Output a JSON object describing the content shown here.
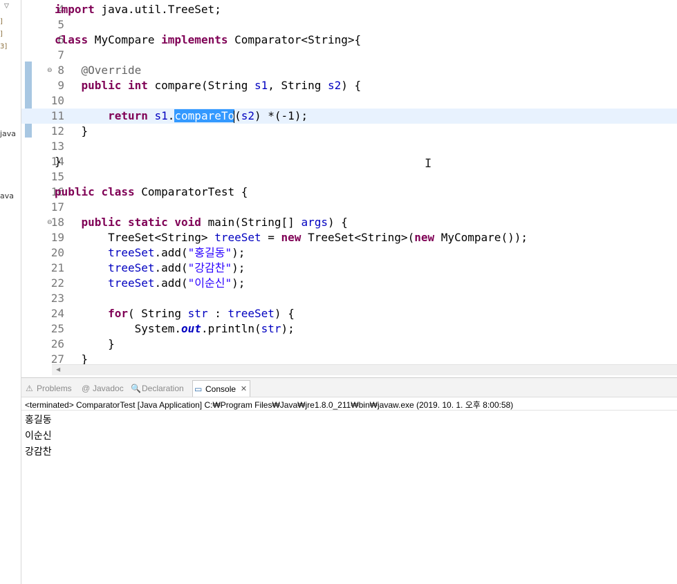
{
  "explorer": {
    "fragments": [
      "]",
      "]",
      "3]",
      "java",
      "ava"
    ]
  },
  "editor": {
    "lines": [
      {
        "num": "4",
        "fold": "",
        "tokens": [
          {
            "t": "import",
            "c": "kw"
          },
          {
            "t": " java.util.TreeSet;",
            "c": ""
          }
        ]
      },
      {
        "num": "5",
        "fold": "",
        "tokens": []
      },
      {
        "num": "6",
        "fold": "",
        "tokens": [
          {
            "t": "class",
            "c": "kw"
          },
          {
            "t": " MyCompare ",
            "c": ""
          },
          {
            "t": "implements",
            "c": "kw"
          },
          {
            "t": " Comparator<String>{",
            "c": ""
          }
        ]
      },
      {
        "num": "7",
        "fold": "",
        "tokens": []
      },
      {
        "num": "8",
        "fold": "⊖",
        "tokens": [
          {
            "t": "    ",
            "c": ""
          },
          {
            "t": "@Override",
            "c": "ann"
          }
        ]
      },
      {
        "num": "9",
        "fold": "",
        "tokens": [
          {
            "t": "    ",
            "c": ""
          },
          {
            "t": "public",
            "c": "kw"
          },
          {
            "t": " ",
            "c": ""
          },
          {
            "t": "int",
            "c": "kw"
          },
          {
            "t": " compare(String ",
            "c": ""
          },
          {
            "t": "s1",
            "c": "fld"
          },
          {
            "t": ", String ",
            "c": ""
          },
          {
            "t": "s2",
            "c": "fld"
          },
          {
            "t": ") {",
            "c": ""
          }
        ]
      },
      {
        "num": "10",
        "fold": "",
        "tokens": []
      },
      {
        "num": "11",
        "fold": "",
        "current": true,
        "tokens": [
          {
            "t": "        ",
            "c": ""
          },
          {
            "t": "return",
            "c": "kw"
          },
          {
            "t": " ",
            "c": ""
          },
          {
            "t": "s1",
            "c": "fld"
          },
          {
            "t": ".",
            "c": ""
          },
          {
            "t": "compareTo",
            "c": "sel"
          },
          {
            "t": "",
            "c": "cursor"
          },
          {
            "t": "(",
            "c": ""
          },
          {
            "t": "s2",
            "c": "fld"
          },
          {
            "t": ") *(-1);",
            "c": ""
          }
        ]
      },
      {
        "num": "12",
        "fold": "",
        "tokens": [
          {
            "t": "    }",
            "c": ""
          }
        ]
      },
      {
        "num": "13",
        "fold": "",
        "tokens": []
      },
      {
        "num": "14",
        "fold": "",
        "tokens": [
          {
            "t": "}",
            "c": ""
          }
        ]
      },
      {
        "num": "15",
        "fold": "",
        "tokens": []
      },
      {
        "num": "16",
        "fold": "",
        "tokens": [
          {
            "t": "public",
            "c": "kw"
          },
          {
            "t": " ",
            "c": ""
          },
          {
            "t": "class",
            "c": "kw"
          },
          {
            "t": " ComparatorTest {",
            "c": ""
          }
        ]
      },
      {
        "num": "17",
        "fold": "",
        "tokens": []
      },
      {
        "num": "18",
        "fold": "⊖",
        "tokens": [
          {
            "t": "    ",
            "c": ""
          },
          {
            "t": "public",
            "c": "kw"
          },
          {
            "t": " ",
            "c": ""
          },
          {
            "t": "static",
            "c": "kw"
          },
          {
            "t": " ",
            "c": ""
          },
          {
            "t": "void",
            "c": "kw"
          },
          {
            "t": " main(String[] ",
            "c": ""
          },
          {
            "t": "args",
            "c": "fld"
          },
          {
            "t": ") {",
            "c": ""
          }
        ]
      },
      {
        "num": "19",
        "fold": "",
        "tokens": [
          {
            "t": "        TreeSet<String> ",
            "c": ""
          },
          {
            "t": "treeSet",
            "c": "fld"
          },
          {
            "t": " = ",
            "c": ""
          },
          {
            "t": "new",
            "c": "kw"
          },
          {
            "t": " TreeSet<String>(",
            "c": ""
          },
          {
            "t": "new",
            "c": "kw"
          },
          {
            "t": " MyCompare());",
            "c": ""
          }
        ]
      },
      {
        "num": "20",
        "fold": "",
        "tokens": [
          {
            "t": "        ",
            "c": ""
          },
          {
            "t": "treeSet",
            "c": "fld"
          },
          {
            "t": ".add(",
            "c": ""
          },
          {
            "t": "\"홍길동\"",
            "c": "str"
          },
          {
            "t": ");",
            "c": ""
          }
        ]
      },
      {
        "num": "21",
        "fold": "",
        "tokens": [
          {
            "t": "        ",
            "c": ""
          },
          {
            "t": "treeSet",
            "c": "fld"
          },
          {
            "t": ".add(",
            "c": ""
          },
          {
            "t": "\"강감찬\"",
            "c": "str"
          },
          {
            "t": ");",
            "c": ""
          }
        ]
      },
      {
        "num": "22",
        "fold": "",
        "tokens": [
          {
            "t": "        ",
            "c": ""
          },
          {
            "t": "treeSet",
            "c": "fld"
          },
          {
            "t": ".add(",
            "c": ""
          },
          {
            "t": "\"이순신\"",
            "c": "str"
          },
          {
            "t": ");",
            "c": ""
          }
        ]
      },
      {
        "num": "23",
        "fold": "",
        "tokens": []
      },
      {
        "num": "24",
        "fold": "",
        "tokens": [
          {
            "t": "        ",
            "c": ""
          },
          {
            "t": "for",
            "c": "kw"
          },
          {
            "t": "( String ",
            "c": ""
          },
          {
            "t": "str",
            "c": "fld"
          },
          {
            "t": " : ",
            "c": ""
          },
          {
            "t": "treeSet",
            "c": "fld"
          },
          {
            "t": ") {",
            "c": ""
          }
        ]
      },
      {
        "num": "25",
        "fold": "",
        "tokens": [
          {
            "t": "            System.",
            "c": ""
          },
          {
            "t": "out",
            "c": "sfield"
          },
          {
            "t": ".println(",
            "c": ""
          },
          {
            "t": "str",
            "c": "fld"
          },
          {
            "t": ");",
            "c": ""
          }
        ]
      },
      {
        "num": "26",
        "fold": "",
        "tokens": [
          {
            "t": "        }",
            "c": ""
          }
        ]
      },
      {
        "num": "27",
        "fold": "",
        "tokens": [
          {
            "t": "    }",
            "c": ""
          }
        ]
      }
    ]
  },
  "bottom_panel": {
    "tabs": [
      {
        "label": "Problems",
        "icon": "problems-icon",
        "glyph": "⚠",
        "active": false
      },
      {
        "label": "Javadoc",
        "icon": "at-icon",
        "glyph": "@",
        "active": false
      },
      {
        "label": "Declaration",
        "icon": "declaration-icon",
        "glyph": "🔍",
        "active": false
      },
      {
        "label": "Console",
        "icon": "console-icon",
        "glyph": "▭",
        "active": true,
        "close": "✕"
      }
    ],
    "terminated_line": "<terminated> ComparatorTest [Java Application] C:₩Program Files₩Java₩jre1.8.0_211₩bin₩javaw.exe (2019. 10. 1. 오후 8:00:58)",
    "output": [
      "홍길동",
      "이순신",
      "강감찬"
    ]
  },
  "colors": {
    "keyword": "#7f0055",
    "field": "#0000c0",
    "string": "#2a00ff",
    "annotation": "#646464",
    "selection": "#3399ff",
    "current_line": "#e8f2fe"
  }
}
